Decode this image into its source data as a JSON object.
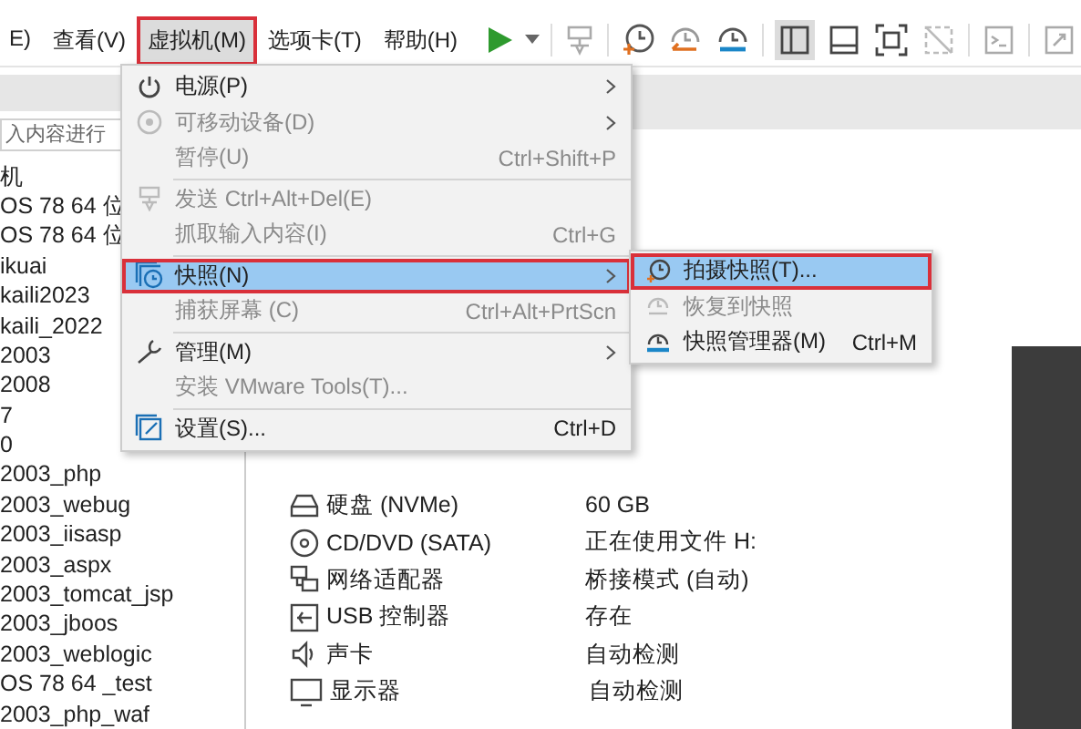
{
  "menubar": [
    {
      "label": "E)",
      "selected": false,
      "annotated": false
    },
    {
      "label": "查看(V)",
      "selected": false,
      "annotated": false
    },
    {
      "label": "虚拟机(M)",
      "selected": true,
      "annotated": true
    },
    {
      "label": "选项卡(T)",
      "selected": false,
      "annotated": false
    },
    {
      "label": "帮助(H)",
      "selected": false,
      "annotated": false
    }
  ],
  "sidebar": {
    "search": {
      "placeholder": "入内容进行"
    },
    "items": [
      "机",
      "OS 78 64 位",
      "OS 78 64 位",
      "ikuai",
      "kaili2023",
      "kaili_2022",
      "2003",
      "2008",
      "7",
      "0",
      "2003_php",
      "2003_webug",
      "2003_iisasp",
      "2003_aspx",
      "2003_tomcat_jsp",
      "2003_jboos",
      "2003_weblogic",
      "OS 78 64 _test",
      "2003_php_waf"
    ]
  },
  "devices": [
    {
      "name": "硬盘 (NVMe)",
      "value": "60 GB"
    },
    {
      "name": "CD/DVD (SATA)",
      "value": "正在使用文件 H:"
    },
    {
      "name": "网络适配器",
      "value": "桥接模式 (自动)"
    },
    {
      "name": "USB 控制器",
      "value": "存在"
    },
    {
      "name": "声卡",
      "value": "自动检测"
    },
    {
      "name": "显示器",
      "value": "自动检测"
    }
  ],
  "menu": [
    {
      "kind": "item",
      "label": "电源(P)",
      "submenu": true,
      "disabled": false,
      "selected": false,
      "annotated": false
    },
    {
      "kind": "item",
      "label": "可移动设备(D)",
      "submenu": true,
      "disabled": true,
      "selected": false,
      "annotated": false
    },
    {
      "kind": "item",
      "label": "暂停(U)",
      "shortcut": "Ctrl+Shift+P",
      "submenu": false,
      "disabled": true,
      "selected": false,
      "annotated": false
    },
    {
      "kind": "separator"
    },
    {
      "kind": "item",
      "label": "发送 Ctrl+Alt+Del(E)",
      "submenu": false,
      "disabled": true,
      "selected": false,
      "annotated": false
    },
    {
      "kind": "item",
      "label": "抓取输入内容(I)",
      "shortcut": "Ctrl+G",
      "submenu": false,
      "disabled": true,
      "selected": false,
      "annotated": false
    },
    {
      "kind": "separator"
    },
    {
      "kind": "item",
      "label": "快照(N)",
      "submenu": true,
      "disabled": false,
      "selected": true,
      "annotated": true
    },
    {
      "kind": "item",
      "label": "捕获屏幕 (C)",
      "shortcut": "Ctrl+Alt+PrtScn",
      "submenu": false,
      "disabled": true,
      "selected": false,
      "annotated": false
    },
    {
      "kind": "separator"
    },
    {
      "kind": "item",
      "label": "管理(M)",
      "submenu": true,
      "disabled": false,
      "selected": false,
      "annotated": false
    },
    {
      "kind": "item",
      "label": "安装 VMware Tools(T)...",
      "submenu": false,
      "disabled": true,
      "selected": false,
      "annotated": false
    },
    {
      "kind": "separator"
    },
    {
      "kind": "item",
      "label": "设置(S)...",
      "shortcut": "Ctrl+D",
      "submenu": false,
      "disabled": false,
      "selected": false,
      "annotated": false
    }
  ],
  "submenu": [
    {
      "label": "拍摄快照(T)...",
      "disabled": false,
      "selected": true,
      "annotated": true
    },
    {
      "label": "恢复到快照",
      "disabled": true,
      "selected": false,
      "annotated": false
    },
    {
      "label": "快照管理器(M)",
      "shortcut": "Ctrl+M",
      "disabled": false,
      "selected": false,
      "annotated": false
    }
  ]
}
